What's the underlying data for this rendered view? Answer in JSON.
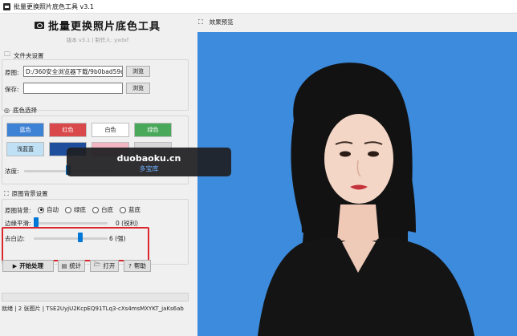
{
  "window": {
    "title": "批量更换照片底色工具 v3.1"
  },
  "header": {
    "title": "批量更换照片底色工具",
    "subtitle": "版本 v3.1 | 制作人: yxdxf"
  },
  "folder": {
    "section_label": "文件夹设置",
    "source_label": "原图:",
    "source_value": "D:/360安全浏览器下载/9b0bad59d",
    "save_label": "保存:",
    "save_value": "",
    "browse_label": "浏览"
  },
  "colors": {
    "section_label": "底色选择",
    "swatches": [
      {
        "label": "蓝色",
        "bg": "#3e82d6",
        "fg": "#ffffff"
      },
      {
        "label": "红色",
        "bg": "#d9494c",
        "fg": "#ffffff"
      },
      {
        "label": "白色",
        "bg": "#ffffff",
        "fg": "#222222"
      },
      {
        "label": "绿色",
        "bg": "#4aa85a",
        "fg": "#ffffff"
      },
      {
        "label": "浅蓝蓝",
        "bg": "#bfe0f5",
        "fg": "#222222"
      },
      {
        "label": "",
        "bg": "#1f4f9c",
        "fg": "#ffffff"
      },
      {
        "label": "",
        "bg": "#f3b6c1",
        "fg": "#222222"
      },
      {
        "label": "",
        "bg": "#d7d7d7",
        "fg": "#222222"
      }
    ],
    "opacity_label": "浓度:",
    "opacity_value": 0.5
  },
  "background": {
    "section_label": "原图背景设置",
    "bg_label": "原图背景:",
    "options": [
      {
        "label": "自动",
        "selected": true
      },
      {
        "label": "绿底",
        "selected": false
      },
      {
        "label": "白底",
        "selected": false
      },
      {
        "label": "蓝底",
        "selected": false
      }
    ],
    "smooth_label": "边缘平滑:",
    "smooth_value": 0,
    "smooth_text": "0 (锐利)",
    "trim_label": "去白边:",
    "trim_value": 6,
    "trim_text": "6 (强)"
  },
  "actions": {
    "start_label": "开始处理",
    "stats_label": "统计",
    "open_label": "打开",
    "help_label": "帮助"
  },
  "status": {
    "text": "就绪 | 2 张图片 | TSE2UyjU2KcpEQ91TLq3-cXs4msMXYKT_jaKs6ab"
  },
  "preview": {
    "title": "效果预览",
    "bg_color": "#3d8bdc"
  },
  "watermark": {
    "line1": "duobaoku.cn",
    "line2": "多宝库"
  }
}
